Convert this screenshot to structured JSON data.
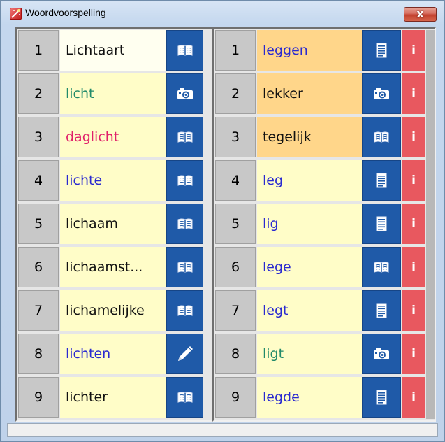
{
  "window": {
    "title": "Woordvoorspelling",
    "close_label": "x"
  },
  "colors": {
    "icon_bg": "#1f5aa8",
    "info_bg": "#e8585f",
    "cream": "#fffdc8",
    "orange": "#ffd68a",
    "white_sel": "#fffff0",
    "blue_text": "#2a2ad0",
    "teal_text": "#218a6a",
    "pink_text": "#e0206a",
    "black_text": "#111111"
  },
  "left_list": [
    {
      "num": "1",
      "word": "Lichtaart",
      "color": "black",
      "bg": "white",
      "icon": "book-icon"
    },
    {
      "num": "2",
      "word": "licht",
      "color": "teal",
      "bg": "cream",
      "icon": "camera-icon"
    },
    {
      "num": "3",
      "word": "daglicht",
      "color": "pink",
      "bg": "cream",
      "icon": "book-icon"
    },
    {
      "num": "4",
      "word": "lichte",
      "color": "blue",
      "bg": "cream",
      "icon": "book-icon"
    },
    {
      "num": "5",
      "word": "lichaam",
      "color": "black",
      "bg": "cream",
      "icon": "book-icon"
    },
    {
      "num": "6",
      "word": "lichaamst...",
      "color": "black",
      "bg": "cream",
      "icon": "book-icon"
    },
    {
      "num": "7",
      "word": "lichamelijke",
      "color": "black",
      "bg": "cream",
      "icon": "book-icon"
    },
    {
      "num": "8",
      "word": "lichten",
      "color": "blue",
      "bg": "cream",
      "icon": "pencil-icon"
    },
    {
      "num": "9",
      "word": "lichter",
      "color": "black",
      "bg": "cream",
      "icon": "book-icon"
    }
  ],
  "right_list": [
    {
      "num": "1",
      "word": "leggen",
      "color": "blue",
      "bg": "orange",
      "icon": "document-icon",
      "info": "i"
    },
    {
      "num": "2",
      "word": "lekker",
      "color": "black",
      "bg": "orange",
      "icon": "camera-icon",
      "info": "i"
    },
    {
      "num": "3",
      "word": "tegelijk",
      "color": "black",
      "bg": "orange",
      "icon": "book-icon",
      "info": "i"
    },
    {
      "num": "4",
      "word": "leg",
      "color": "blue",
      "bg": "cream",
      "icon": "document-icon",
      "info": "i"
    },
    {
      "num": "5",
      "word": "lig",
      "color": "blue",
      "bg": "cream",
      "icon": "document-icon",
      "info": "i"
    },
    {
      "num": "6",
      "word": "lege",
      "color": "blue",
      "bg": "cream",
      "icon": "book-icon",
      "info": "i"
    },
    {
      "num": "7",
      "word": "legt",
      "color": "blue",
      "bg": "cream",
      "icon": "document-icon",
      "info": "i"
    },
    {
      "num": "8",
      "word": "ligt",
      "color": "teal",
      "bg": "cream",
      "icon": "camera-icon",
      "info": "i"
    },
    {
      "num": "9",
      "word": "legde",
      "color": "blue",
      "bg": "cream",
      "icon": "document-icon",
      "info": "i"
    }
  ]
}
